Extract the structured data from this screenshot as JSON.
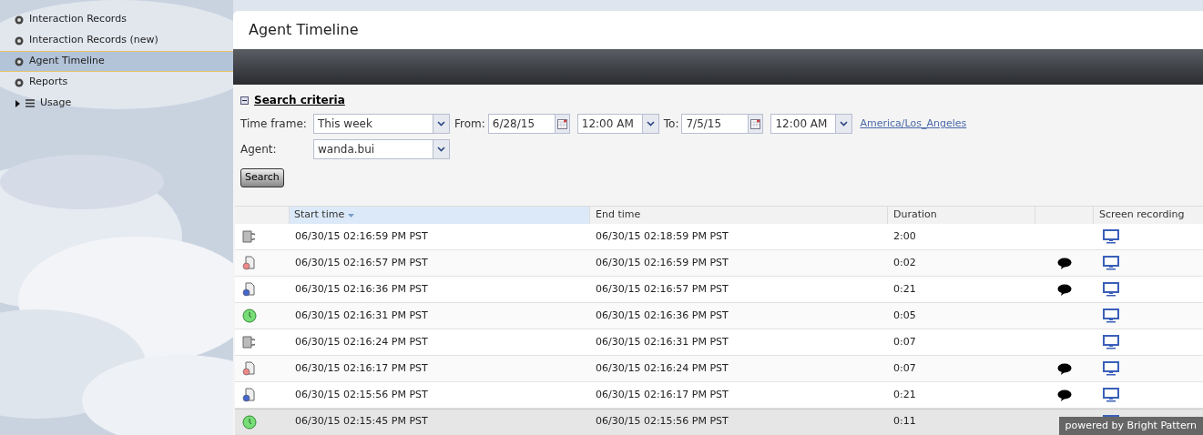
{
  "sidebar": {
    "items": [
      {
        "label": "Interaction Records",
        "kind": "item",
        "selected": false
      },
      {
        "label": "Interaction Records (new)",
        "kind": "item",
        "selected": false
      },
      {
        "label": "Agent Timeline",
        "kind": "item",
        "selected": true
      },
      {
        "label": "Reports",
        "kind": "item",
        "selected": false
      },
      {
        "label": "Usage",
        "kind": "group",
        "expanded": false,
        "selected": false
      }
    ]
  },
  "page": {
    "title": "Agent Timeline"
  },
  "search_criteria": {
    "title": "Search criteria",
    "expanded": true,
    "time_frame": {
      "label": "Time frame:",
      "value": "This week"
    },
    "from": {
      "label": "From:",
      "date": "6/28/15",
      "time": "12:00 AM"
    },
    "to": {
      "label": "To:",
      "date": "7/5/15",
      "time": "12:00 AM"
    },
    "timezone_link": "America/Los_Angeles",
    "agent": {
      "label": "Agent:",
      "value": "wanda.bui"
    },
    "search_button": "Search"
  },
  "table": {
    "columns": [
      {
        "label": "Start time",
        "sorted": true
      },
      {
        "label": "End time",
        "sorted": false
      },
      {
        "label": "Duration",
        "sorted": false
      },
      {
        "label": "Screen recording",
        "sorted": false
      }
    ],
    "rows": [
      {
        "kind": "break",
        "start": "06/30/15 02:16:59 PM PST",
        "end": "06/30/15 02:18:59 PM PST",
        "duration": "2:00",
        "comment": false,
        "selected": false
      },
      {
        "kind": "call_out",
        "start": "06/30/15 02:16:57 PM PST",
        "end": "06/30/15 02:16:59 PM PST",
        "duration": "0:02",
        "comment": true,
        "selected": false
      },
      {
        "kind": "call_in",
        "start": "06/30/15 02:16:36 PM PST",
        "end": "06/30/15 02:16:57 PM PST",
        "duration": "0:21",
        "comment": true,
        "selected": false
      },
      {
        "kind": "ready",
        "start": "06/30/15 02:16:31 PM PST",
        "end": "06/30/15 02:16:36 PM PST",
        "duration": "0:05",
        "comment": false,
        "selected": false
      },
      {
        "kind": "break",
        "start": "06/30/15 02:16:24 PM PST",
        "end": "06/30/15 02:16:31 PM PST",
        "duration": "0:07",
        "comment": false,
        "selected": false
      },
      {
        "kind": "call_out",
        "start": "06/30/15 02:16:17 PM PST",
        "end": "06/30/15 02:16:24 PM PST",
        "duration": "0:07",
        "comment": true,
        "selected": false
      },
      {
        "kind": "call_in",
        "start": "06/30/15 02:15:56 PM PST",
        "end": "06/30/15 02:16:17 PM PST",
        "duration": "0:21",
        "comment": true,
        "selected": false
      },
      {
        "kind": "ready",
        "start": "06/30/15 02:15:45 PM PST",
        "end": "06/30/15 02:15:56 PM PST",
        "duration": "0:11",
        "comment": false,
        "selected": true
      }
    ]
  },
  "footer_badge": "powered by Bright Pattern"
}
